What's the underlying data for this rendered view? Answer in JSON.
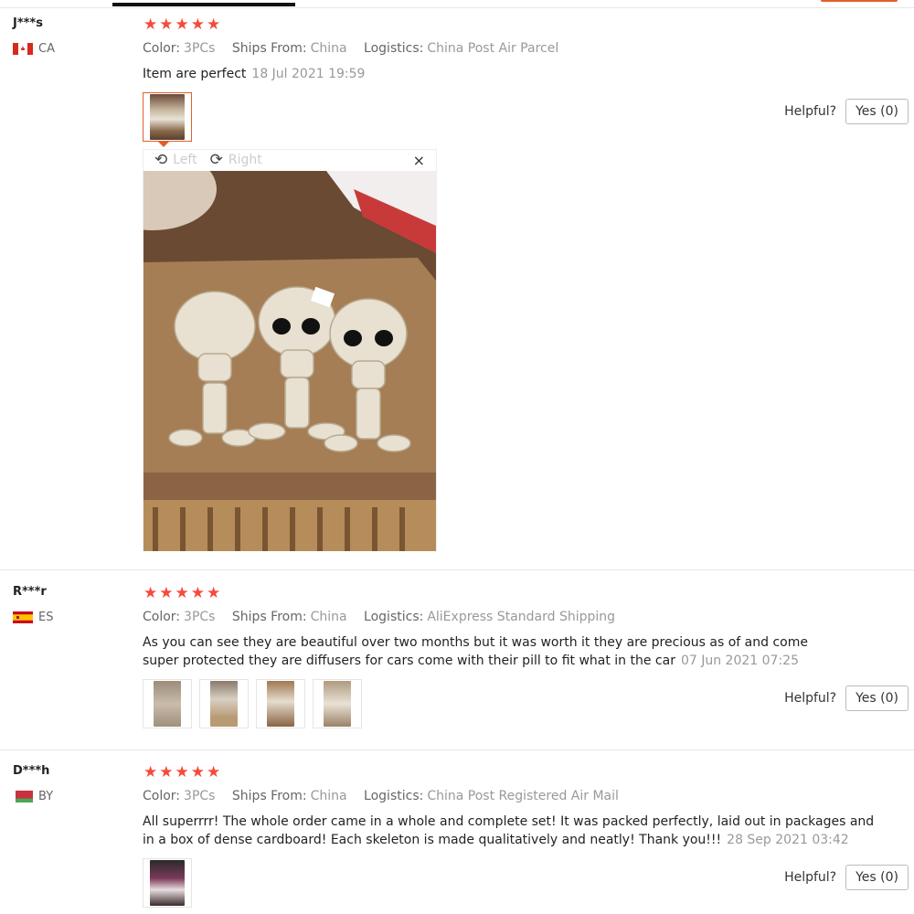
{
  "reviews": [
    {
      "user": "J***s",
      "country": "CA",
      "flag": "ca-flag",
      "stars": 5,
      "color_label": "Color:",
      "color": "3PCs",
      "ships_label": "Ships From:",
      "ships": "China",
      "logistics_label": "Logistics:",
      "logistics": "China Post Air Parcel",
      "text": "Item are perfect",
      "date": "18 Jul 2021 19:59",
      "helpful_label": "Helpful?",
      "yes_label": "Yes (0)"
    },
    {
      "user": "R***r",
      "country": "ES",
      "flag": "es-flag",
      "stars": 5,
      "color_label": "Color:",
      "color": "3PCs",
      "ships_label": "Ships From:",
      "ships": "China",
      "logistics_label": "Logistics:",
      "logistics": "AliExpress Standard Shipping",
      "text": "As you can see they are beautiful over two months but it was worth it they are precious as of and come super protected they are diffusers for cars come with their pill to fit what in the car",
      "date": "07 Jun 2021 07:25",
      "helpful_label": "Helpful?",
      "yes_label": "Yes (0)"
    },
    {
      "user": "D***h",
      "country": "BY",
      "flag": "by-flag",
      "stars": 5,
      "color_label": "Color:",
      "color": "3PCs",
      "ships_label": "Ships From:",
      "ships": "China",
      "logistics_label": "Logistics:",
      "logistics": "China Post Registered Air Mail",
      "text": "All superrrr! The whole order came in a whole and complete set! It was packed perfectly, laid out in packages and in a box of dense cardboard! Each skeleton is made qualitatively and neatly! Thank you!!!",
      "date": "28 Sep 2021 03:42",
      "helpful_label": "Helpful?",
      "yes_label": "Yes (0)"
    }
  ],
  "viewer": {
    "left_label": "Left",
    "right_label": "Right",
    "close_glyph": "×",
    "rotate_left_glyph": "⟲",
    "rotate_right_glyph": "⟳"
  },
  "star_glyph": "★",
  "colors": {
    "star": "#f44b3b",
    "accent": "#e0602a"
  }
}
